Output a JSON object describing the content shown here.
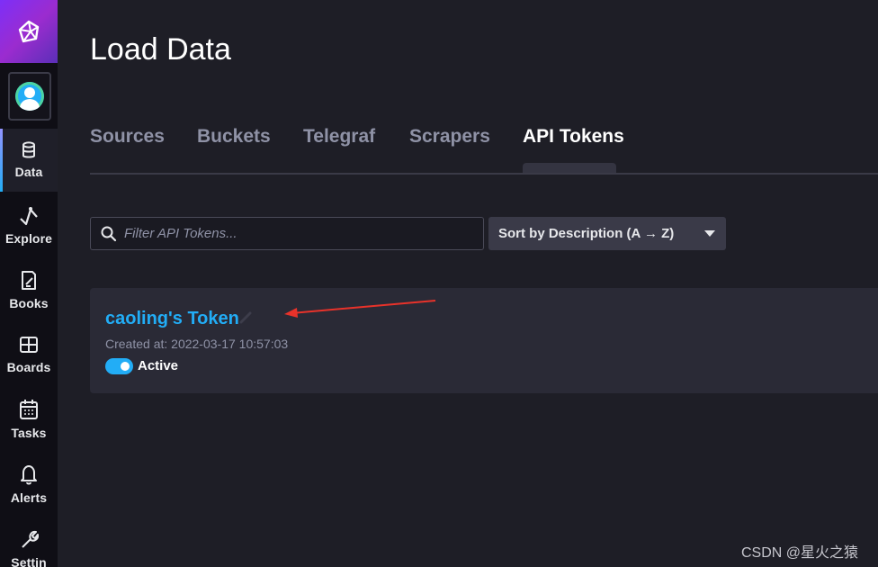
{
  "sidebar": {
    "nav": [
      {
        "label": "Data",
        "icon": "database-icon",
        "active": true
      },
      {
        "label": "Explore",
        "icon": "graph-icon",
        "active": false
      },
      {
        "label": "Books",
        "icon": "notebook-icon",
        "active": false
      },
      {
        "label": "Boards",
        "icon": "dashboard-grid-icon",
        "active": false
      },
      {
        "label": "Tasks",
        "icon": "calendar-icon",
        "active": false
      },
      {
        "label": "Alerts",
        "icon": "bell-icon",
        "active": false
      },
      {
        "label": "Settin",
        "icon": "wrench-icon",
        "active": false
      }
    ]
  },
  "main": {
    "title": "Load Data",
    "tabs": [
      {
        "label": "Sources",
        "active": false
      },
      {
        "label": "Buckets",
        "active": false
      },
      {
        "label": "Telegraf",
        "active": false
      },
      {
        "label": "Scrapers",
        "active": false
      },
      {
        "label": "API Tokens",
        "active": true
      }
    ],
    "search": {
      "placeholder": "Filter API Tokens...",
      "value": ""
    },
    "sort": {
      "selected": "Sort by Description (A → Z)"
    },
    "tokens": [
      {
        "name": "caoling's Token",
        "created": "Created at: 2022-03-17 10:57:03",
        "status": "Active",
        "enabled": true
      }
    ]
  },
  "watermark": "CSDN @星火之猿",
  "colors": {
    "accent": "#22adf6",
    "background": "#1e1e26",
    "sidebar": "#0f0e15",
    "annotation_arrow": "#e8322a"
  }
}
